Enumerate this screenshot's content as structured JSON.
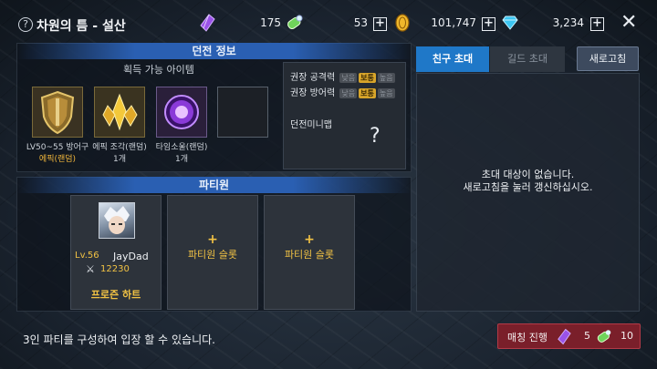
{
  "header": {
    "title": "차원의 틈 - 설산",
    "help_icon": "?",
    "resources": [
      {
        "icon": "purple-crystal-icon",
        "value": "175"
      },
      {
        "icon": "green-potion-icon",
        "value": "53"
      },
      {
        "icon": "gold-coin-icon",
        "value": "101,747"
      },
      {
        "icon": "blue-diamond-icon",
        "value": "3,234"
      }
    ],
    "close_icon": "✕"
  },
  "dungeon_info": {
    "header": "던전 정보",
    "items_subhead": "획득 가능 아이템",
    "items": [
      {
        "name_line1": "LV50~55 방어구",
        "name_line2": "에픽(랜덤)",
        "icon": "shield-icon"
      },
      {
        "name_line1": "에픽 조각(랜덤)",
        "name_line2": "1개",
        "icon": "gold-shard-icon"
      },
      {
        "name_line1": "타임소울(랜덤)",
        "name_line2": "1개",
        "icon": "time-soul-icon"
      },
      {
        "name_line1": "",
        "name_line2": "",
        "icon": "empty-slot"
      }
    ],
    "recommend": [
      {
        "label": "권장 공격력",
        "tags": [
          "낮음",
          "보통",
          "높음"
        ]
      },
      {
        "label": "권장 방어력",
        "tags": [
          "낮음",
          "보통",
          "높음"
        ]
      }
    ],
    "minimap_label": "던전미니맵",
    "minimap_placeholder": "?"
  },
  "party": {
    "header": "파티원",
    "member": {
      "level": "Lv.56",
      "name": "JayDad",
      "power": "12230",
      "class": "프로즌 하트"
    },
    "empty_slot_plus": "+",
    "empty_slot_label": "파티원 슬롯"
  },
  "invite": {
    "tabs": [
      "친구 초대",
      "길드 초대"
    ],
    "refresh_label": "새로고침",
    "empty_line1": "초대 대상이 없습니다.",
    "empty_line2": "새로고침을 눌러 갱신하십시오."
  },
  "footer": {
    "message": "3인 파티를 구성하여 입장 할 수 있습니다.",
    "match_label": "매칭 진행",
    "cost_crystal": "5",
    "cost_potion": "10"
  },
  "colors": {
    "accent_blue": "#1f78c8",
    "gold": "#f1c244",
    "match_red": "#7a1f2a"
  }
}
